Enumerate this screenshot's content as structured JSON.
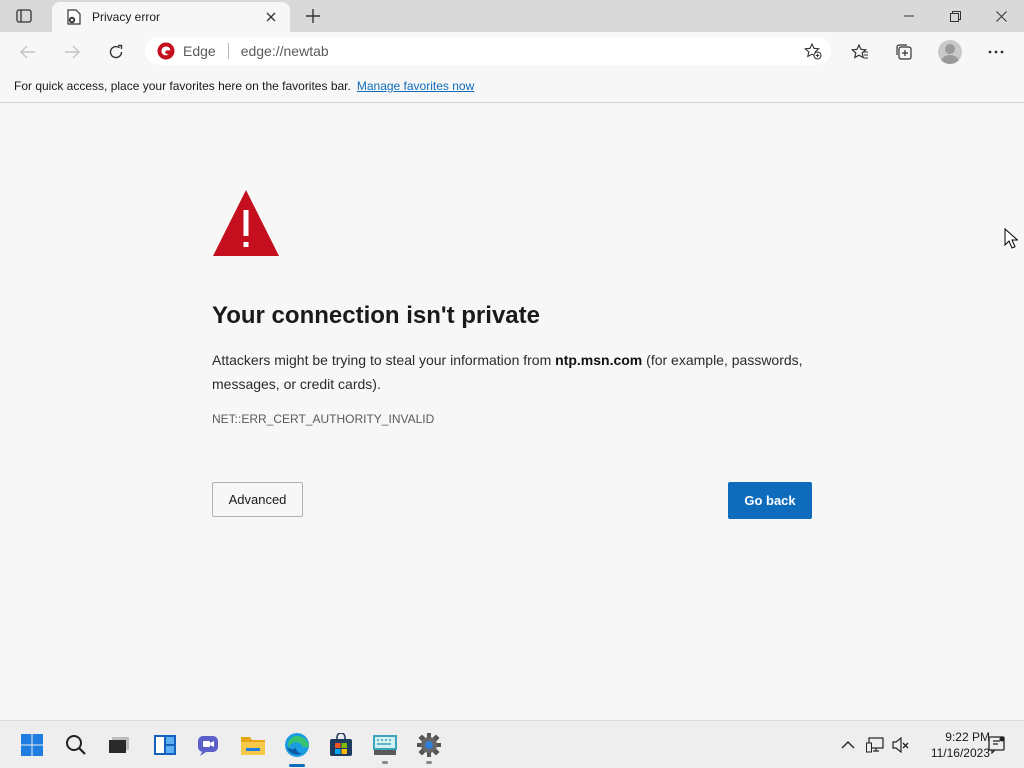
{
  "browser": {
    "tab": {
      "title": "Privacy error"
    },
    "address": {
      "site_label": "Edge",
      "url": "edge://newtab"
    },
    "favorites_bar": {
      "text": "For quick access, place your favorites here on the favorites bar.",
      "link": "Manage favorites now"
    }
  },
  "error_page": {
    "title": "Your connection isn't private",
    "desc_before": "Attackers might be trying to steal your information from ",
    "host": "ntp.msn.com",
    "desc_after": " (for example, passwords, messages, or credit cards).",
    "code": "NET::ERR_CERT_AUTHORITY_INVALID",
    "advanced_label": "Advanced",
    "go_back_label": "Go back"
  },
  "taskbar": {
    "time": "9:22 PM",
    "date": "11/16/2023",
    "apps": [
      "start-icon",
      "search-icon",
      "terminal-icon",
      "widgets-icon",
      "teams-chat-icon",
      "file-explorer-icon",
      "edge-icon",
      "store-icon",
      "keyboard-icon",
      "settings-icon"
    ]
  },
  "colors": {
    "accent": "#0f6cbd",
    "warning": "#c50f1f"
  }
}
